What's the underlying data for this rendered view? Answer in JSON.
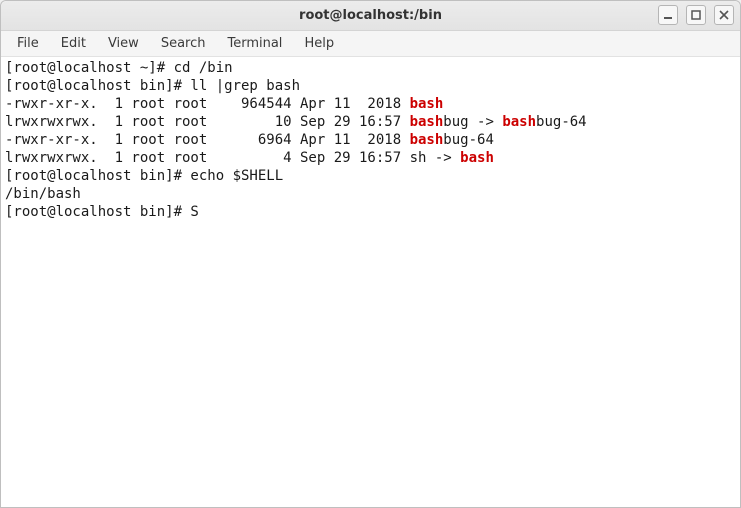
{
  "window": {
    "title": "root@localhost:/bin"
  },
  "menubar": {
    "items": [
      "File",
      "Edit",
      "View",
      "Search",
      "Terminal",
      "Help"
    ]
  },
  "terminal": {
    "lines": [
      {
        "segments": [
          {
            "text": "[root@localhost ~]# cd /bin"
          }
        ]
      },
      {
        "segments": [
          {
            "text": "[root@localhost bin]# ll |grep bash"
          }
        ]
      },
      {
        "segments": [
          {
            "text": "-rwxr-xr-x.  1 root root    964544 Apr 11  2018 "
          },
          {
            "text": "bash",
            "hl": true
          }
        ]
      },
      {
        "segments": [
          {
            "text": "lrwxrwxrwx.  1 root root        10 Sep 29 16:57 "
          },
          {
            "text": "bash",
            "hl": true
          },
          {
            "text": "bug -> "
          },
          {
            "text": "bash",
            "hl": true
          },
          {
            "text": "bug-64"
          }
        ]
      },
      {
        "segments": [
          {
            "text": "-rwxr-xr-x.  1 root root      6964 Apr 11  2018 "
          },
          {
            "text": "bash",
            "hl": true
          },
          {
            "text": "bug-64"
          }
        ]
      },
      {
        "segments": [
          {
            "text": "lrwxrwxrwx.  1 root root         4 Sep 29 16:57 sh -> "
          },
          {
            "text": "bash",
            "hl": true
          }
        ]
      },
      {
        "segments": [
          {
            "text": "[root@localhost bin]# echo $SHELL"
          }
        ]
      },
      {
        "segments": [
          {
            "text": "/bin/bash"
          }
        ]
      },
      {
        "segments": [
          {
            "text": "[root@localhost bin]# S"
          }
        ]
      }
    ]
  }
}
